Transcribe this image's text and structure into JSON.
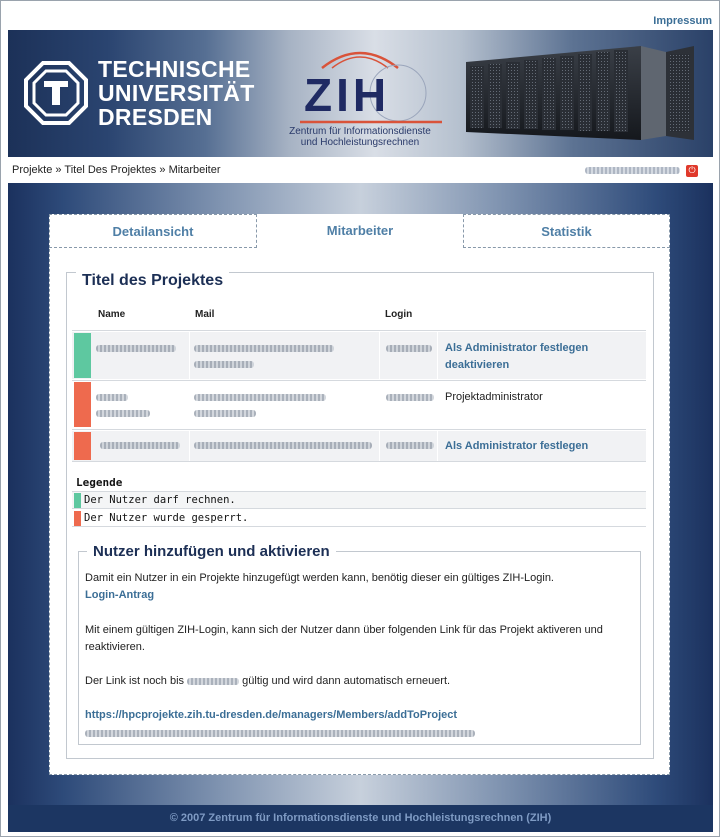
{
  "header": {
    "impressum_label": "Impressum",
    "tud_logo_lines": [
      "TECHNISCHE",
      "UNIVERSITÄT",
      "DRESDEN"
    ],
    "zih_logo_name": "ZIH",
    "zih_logo_subtitle_lines": [
      "Zentrum für Informationsdienste",
      "und Hochleistungsrechnen"
    ]
  },
  "breadcrumb": {
    "items": [
      "Projekte",
      "Titel Des Projektes",
      "Mitarbeiter"
    ],
    "separator": "»"
  },
  "tabs": [
    {
      "label": "Detailansicht",
      "active": false
    },
    {
      "label": "Mitarbeiter",
      "active": true
    },
    {
      "label": "Statistik",
      "active": false
    }
  ],
  "project": {
    "title": "Titel des Projektes",
    "columns": [
      "Name",
      "Mail",
      "Login"
    ],
    "rows": [
      {
        "status": "active",
        "action_lines": [
          "Als Administrator festlegen",
          "deaktivieren"
        ]
      },
      {
        "status": "blocked",
        "role": "Projektadministrator"
      },
      {
        "status": "blocked",
        "action_lines": [
          "Als Administrator festlegen"
        ]
      }
    ]
  },
  "legend": {
    "title": "Legende",
    "items": [
      {
        "color": "#5ec8a0",
        "text": "Der Nutzer darf rechnen."
      },
      {
        "color": "#ee6a4e",
        "text": "Der Nutzer wurde gesperrt."
      }
    ]
  },
  "add_section": {
    "title": "Nutzer hinzufügen und aktivieren",
    "intro": "Damit ein Nutzer in ein Projekte hinzugefügt werden kann, benötig dieser ein gültiges ZIH-Login.",
    "login_link": "Login-Antrag",
    "para2_line1": "Mit einem gültigen ZIH-Login, kann sich der Nutzer dann über folgenden Link für das Projekt aktiveren und",
    "para2_line2": "reaktivieren.",
    "validity_prefix": "Der Link ist noch bis",
    "validity_suffix": "gültig und wird dann automatisch erneuert.",
    "project_link": "https://hpcprojekte.zih.tu-dresden.de/managers/Members/addToProject"
  },
  "colors": {
    "active": "#5ec8a0",
    "blocked": "#ee6a4e",
    "link": "#3b6e96",
    "heading": "#1c2f55"
  },
  "footer": {
    "text": "© 2007 Zentrum für Informationsdienste und Hochleistungsrechnen (ZIH)"
  }
}
